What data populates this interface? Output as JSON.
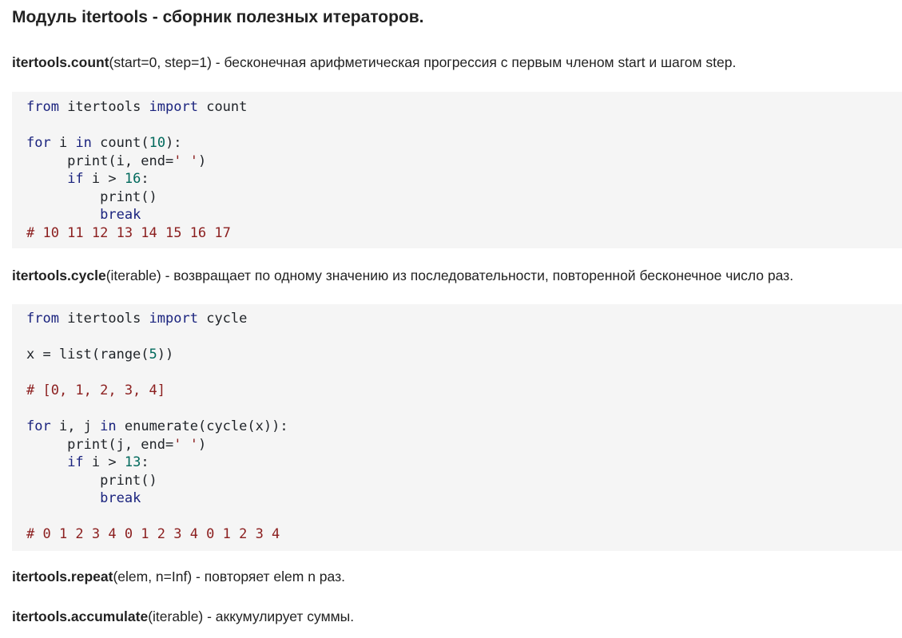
{
  "title": "Модуль itertools - сборник полезных итераторов.",
  "sections": {
    "count": {
      "fn": "itertools.count",
      "desc": "(start=0, step=1) - бесконечная арифметическая прогрессия с первым членом start и шагом step."
    },
    "cycle": {
      "fn": "itertools.cycle",
      "desc": "(iterable) - возвращает по одному значению из последовательности, повторенной бесконечное число раз."
    },
    "repeat": {
      "fn": "itertools.repeat",
      "desc": "(elem, n=Inf) - повторяет elem n раз."
    },
    "accumulate": {
      "fn": "itertools.accumulate",
      "desc": "(iterable) - аккумулирует суммы."
    }
  },
  "code1": {
    "l1": {
      "kw1": "from",
      "t1": " itertools ",
      "kw2": "import",
      "t2": " count"
    },
    "l2": {
      "kw1": "for",
      "t1": " i ",
      "kw2": "in",
      "t2": " count(",
      "n": "10",
      "t3": "):"
    },
    "l3": {
      "t1": "     print(i, end=",
      "s": "' '",
      "t2": ")"
    },
    "l4": {
      "ind": "     ",
      "kw": "if",
      "t1": " i > ",
      "n": "16",
      "t2": ":"
    },
    "l5": {
      "t": "         print()"
    },
    "l6": {
      "ind": "         ",
      "kw": "break"
    },
    "l7": {
      "c": "# 10 11 12 13 14 15 16 17"
    }
  },
  "code2": {
    "l1": {
      "kw1": "from",
      "t1": " itertools ",
      "kw2": "import",
      "t2": " cycle"
    },
    "l2": {
      "t1": "x = list(range(",
      "n": "5",
      "t2": "))"
    },
    "l3": {
      "c": "# [0, 1, 2, 3, 4]"
    },
    "l4": {
      "kw1": "for",
      "t1": " i, j ",
      "kw2": "in",
      "t2": " enumerate(cycle(x)):"
    },
    "l5": {
      "t1": "     print(j, end=",
      "s": "' '",
      "t2": ")"
    },
    "l6": {
      "ind": "     ",
      "kw": "if",
      "t1": " i > ",
      "n": "13",
      "t2": ":"
    },
    "l7": {
      "t": "         print()"
    },
    "l8": {
      "ind": "         ",
      "kw": "break"
    },
    "l9": {
      "c": "# 0 1 2 3 4 0 1 2 3 4 0 1 2 3 4"
    }
  }
}
